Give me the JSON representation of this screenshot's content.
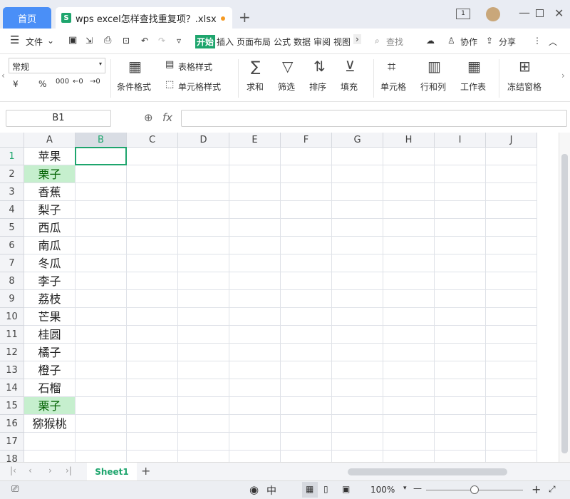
{
  "tabs": {
    "home": "首页",
    "file": "wps excel怎样查找重复项？.xlsx"
  },
  "menu": {
    "file": "文件",
    "items": [
      "开始",
      "插入",
      "页面布局",
      "公式",
      "数据",
      "审阅",
      "视图"
    ],
    "search": "查找",
    "cooperate": "协作",
    "share": "分享"
  },
  "ribbon": {
    "number_format": "常规",
    "currency": "¥",
    "percent": "%",
    "thousands": "000",
    "conditional_format": "条件格式",
    "table_style": "表格样式",
    "cell_style": "单元格样式",
    "sum": "求和",
    "filter": "筛选",
    "sort": "排序",
    "fill": "填充",
    "cell": "单元格",
    "row_col": "行和列",
    "worksheet": "工作表",
    "freeze": "冻结窗格"
  },
  "formula": {
    "name_box": "B1",
    "fx": "fx",
    "value": ""
  },
  "grid": {
    "columns": [
      "A",
      "B",
      "C",
      "D",
      "E",
      "F",
      "G",
      "H",
      "I",
      "J"
    ],
    "rows": [
      "1",
      "2",
      "3",
      "4",
      "5",
      "6",
      "7",
      "8",
      "9",
      "10",
      "11",
      "12",
      "13",
      "14",
      "15",
      "16",
      "17",
      "18"
    ],
    "a_values": [
      "苹果",
      "栗子",
      "香蕉",
      "梨子",
      "西瓜",
      "南瓜",
      "冬瓜",
      "李子",
      "荔枝",
      "芒果",
      "桂圆",
      "橘子",
      "橙子",
      "石榴",
      "栗子",
      "猕猴桃",
      "",
      ""
    ],
    "duplicate_rows": [
      2,
      15
    ],
    "selected": "B1",
    "highlight_color": "#c6efce"
  },
  "sheets": {
    "active": "Sheet1"
  },
  "status": {
    "zoom": "100%"
  }
}
